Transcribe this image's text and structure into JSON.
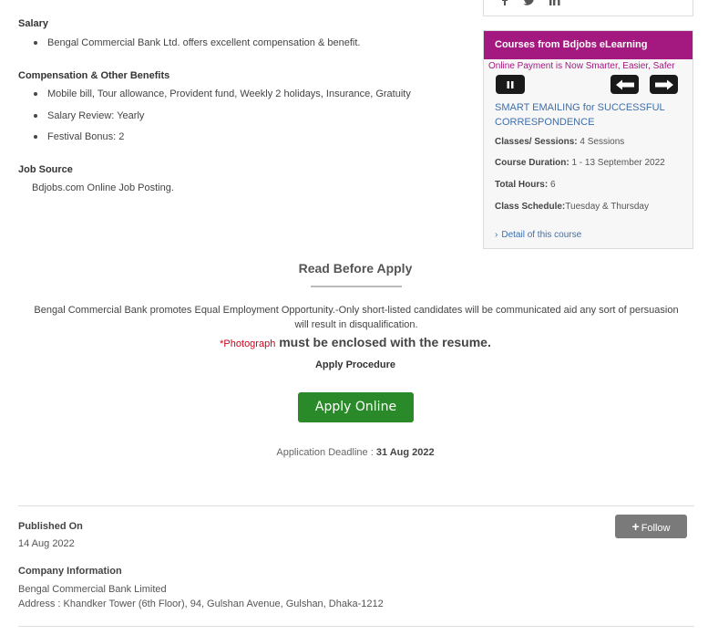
{
  "salary": {
    "title": "Salary",
    "items": [
      "Bengal Commercial Bank Ltd. offers excellent compensation & benefit."
    ]
  },
  "benefits": {
    "title": "Compensation & Other Benefits",
    "items": [
      "Mobile bill, Tour allowance, Provident fund, Weekly 2 holidays, Insurance, Gratuity",
      "Salary Review: Yearly",
      "Festival Bonus: 2"
    ]
  },
  "job_source": {
    "title": "Job Source",
    "text": "Bdjobs.com Online Job Posting."
  },
  "sidebar": {
    "social_icons": [
      "facebook-icon",
      "twitter-icon",
      "linkedin-icon"
    ],
    "course_box": {
      "title": "Courses from Bdjobs eLearning",
      "marquee": "Online Payment is Now Smarter, Easier, Safer",
      "course_title": "SMART EMAILING for SUCCESSFUL CORRESPONDENCE",
      "sessions_label": "Classes/ Sessions:",
      "sessions_value": "4 Sessions",
      "duration_label": "Course Duration:",
      "duration_value": "1 - 13 September 2022",
      "hours_label": "Total Hours:",
      "hours_value": "6",
      "schedule_label": "Class Schedule:",
      "schedule_value": "Tuesday & Thursday",
      "detail_link": "Detail of this course"
    }
  },
  "read_before_apply": {
    "title": "Read Before Apply",
    "text": "Bengal Commercial Bank promotes Equal Employment Opportunity.-Only short-listed candidates will be communicated aid any sort of persuasion will result in disqualification.",
    "photo_mark": "*Photograph",
    "photo_text": "must be enclosed with the resume.",
    "procedure_title": "Apply Procedure",
    "apply_button": "Apply Online",
    "deadline_label": "Application Deadline :",
    "deadline_value": "31 Aug 2022"
  },
  "published": {
    "title": "Published On",
    "date": "14 Aug 2022",
    "follow_button": "Follow"
  },
  "company": {
    "title": "Company Information",
    "name": "Bengal Commercial Bank Limited",
    "address": "Address : Khandker Tower (6th Floor), 94, Gulshan Avenue, Gulshan, Dhaka-1212"
  },
  "colors": {
    "course_header": "#a3197f",
    "apply_button": "#2a8a2a",
    "follow_button": "#7a7a7a",
    "link": "#3f6fab",
    "photo_mark": "#d0021b"
  }
}
